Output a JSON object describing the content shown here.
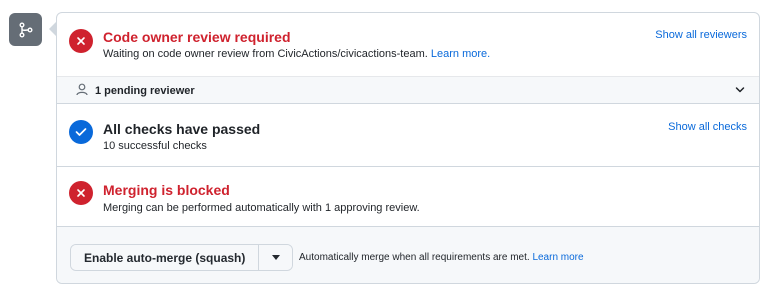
{
  "icons": {
    "git_branch": "git-branch-icon",
    "fail": "x-icon",
    "pass": "check-icon",
    "person": "person-icon",
    "chevron": "chevron-down-icon",
    "caret": "caret-down-icon"
  },
  "colors": {
    "fail": "#cf222e",
    "pass": "#0969da",
    "link": "#0969da",
    "badge": "#656d76"
  },
  "review": {
    "title": "Code owner review required",
    "description": "Waiting on code owner review from CivicActions/civicactions-team.",
    "learn_more": "Learn more.",
    "action": "Show all reviewers"
  },
  "pending": {
    "label": "1 pending reviewer"
  },
  "checks": {
    "title": "All checks have passed",
    "description": "10 successful checks",
    "action": "Show all checks"
  },
  "merge": {
    "title": "Merging is blocked",
    "description": "Merging can be performed automatically with 1 approving review.",
    "button_label": "Enable auto-merge (squash)",
    "note": "Automatically merge when all requirements are met.",
    "note_link": "Learn more"
  }
}
